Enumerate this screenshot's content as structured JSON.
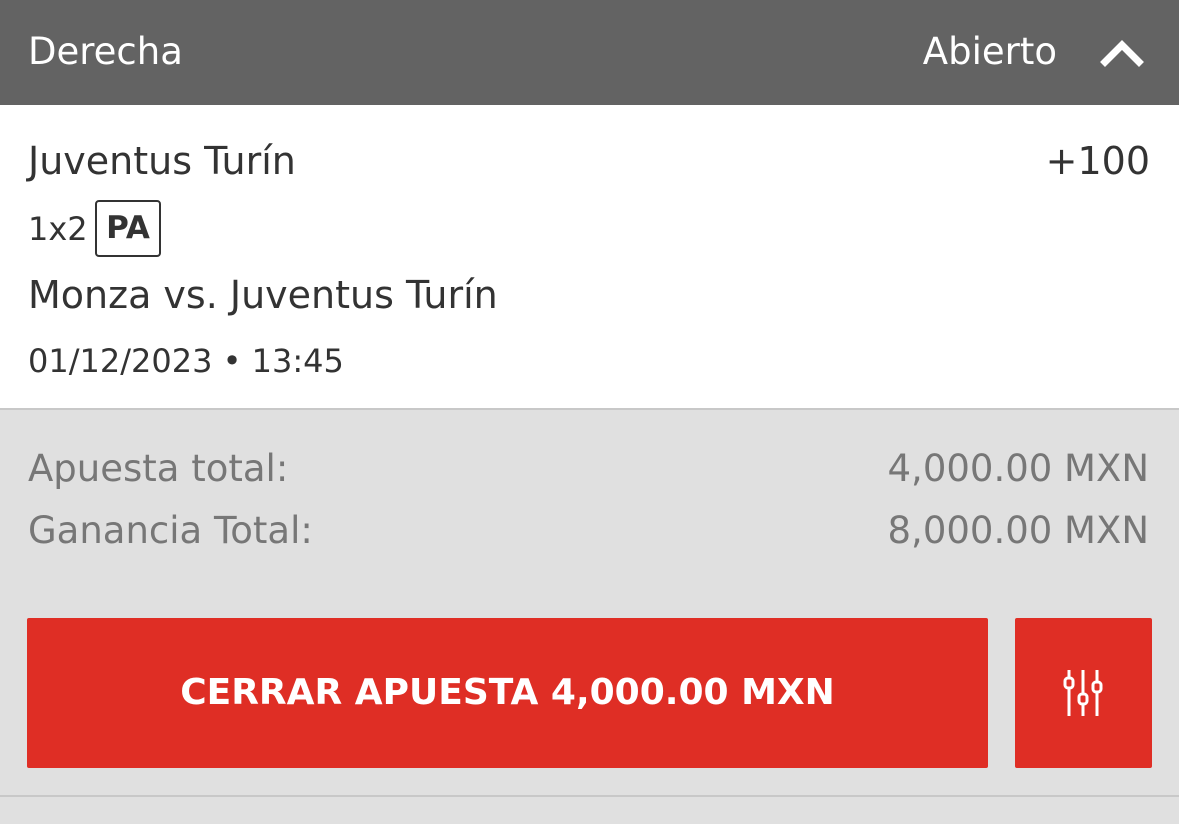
{
  "header": {
    "title": "Derecha",
    "status": "Abierto",
    "collapse_icon": "chevron-up-icon"
  },
  "bet": {
    "selection": "Juventus Turín",
    "odds": "+100",
    "market": "1x2",
    "market_badge": "PA",
    "event": "Monza vs. Juventus Turín",
    "datetime": "01/12/2023 • 13:45"
  },
  "summary": {
    "stake_label": "Apuesta total:",
    "stake_value": "4,000.00 MXN",
    "payout_label": "Ganancia Total:",
    "payout_value": "8,000.00 MXN"
  },
  "actions": {
    "cashout_label": "CERRAR APUESTA 4,000.00 MXN",
    "settings_icon": "sliders-icon"
  },
  "colors": {
    "header_bg": "#636363",
    "accent_red": "#df2e25",
    "panel_bg": "#e0e0e0"
  }
}
